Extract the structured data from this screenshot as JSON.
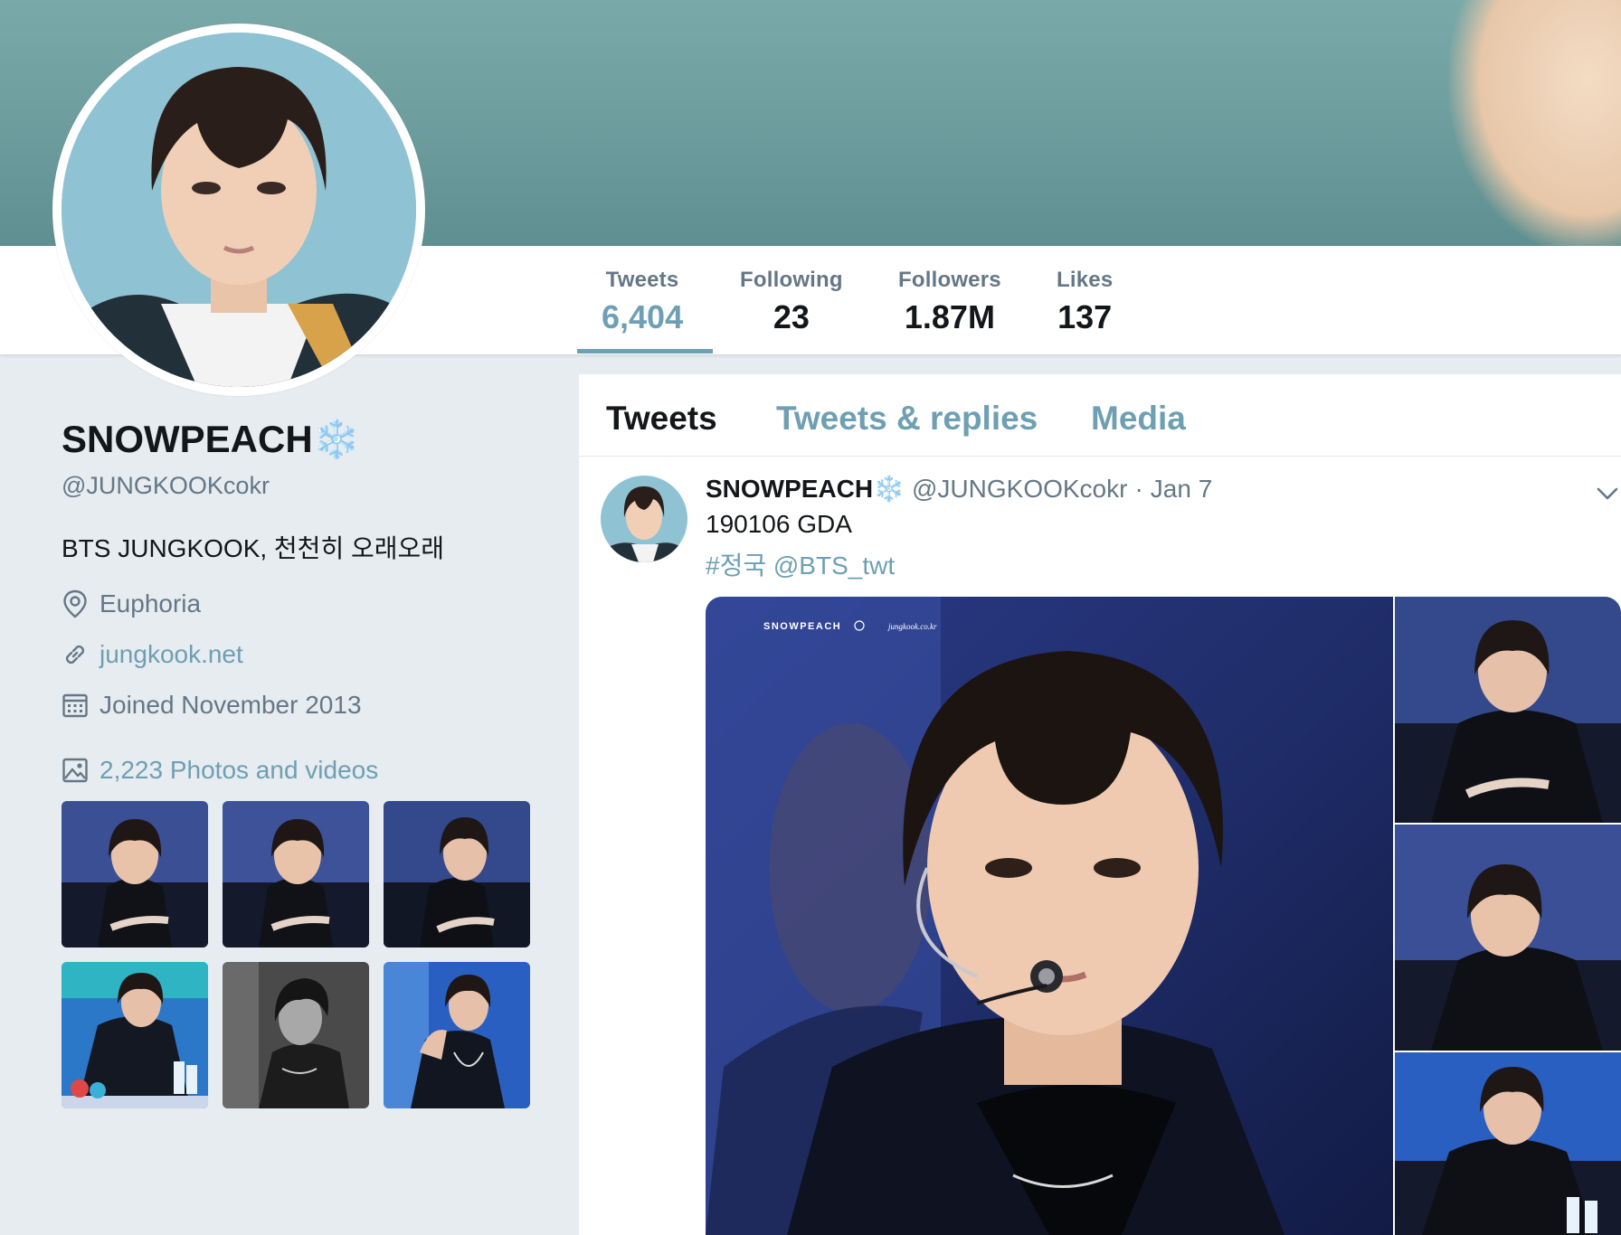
{
  "profile": {
    "display_name": "SNOWPEACH",
    "name_emoji": "❄️",
    "handle": "@JUNGKOOKcokr",
    "bio": "BTS JUNGKOOK, 천천히 오래오래",
    "location": "Euphoria",
    "website": "jungkook.net",
    "joined": "Joined November 2013",
    "photos_videos": "2,223 Photos and videos"
  },
  "stats": [
    {
      "label": "Tweets",
      "value": "6,404"
    },
    {
      "label": "Following",
      "value": "23"
    },
    {
      "label": "Followers",
      "value": "1.87M"
    },
    {
      "label": "Likes",
      "value": "137"
    }
  ],
  "tabs": [
    {
      "label": "Tweets"
    },
    {
      "label": "Tweets & replies"
    },
    {
      "label": "Media"
    }
  ],
  "tweet": {
    "name": "SNOWPEACH",
    "name_emoji": "❄️",
    "handle": "@JUNGKOOKcokr",
    "separator": "·",
    "date": "Jan 7",
    "text": "190106 GDA",
    "hashtag": "#정국",
    "mention": "@BTS_twt"
  },
  "media_watermark": {
    "brand": "SNOWPEACH",
    "site": "jungkook.co.kr"
  },
  "colors": {
    "accent": "#6e9fb3",
    "text": "#14171a",
    "muted": "#657786",
    "page_bg": "#e6ecf0"
  },
  "icons": [
    "location-pin-icon",
    "link-icon",
    "calendar-icon",
    "image-icon",
    "chevron-down-icon"
  ]
}
